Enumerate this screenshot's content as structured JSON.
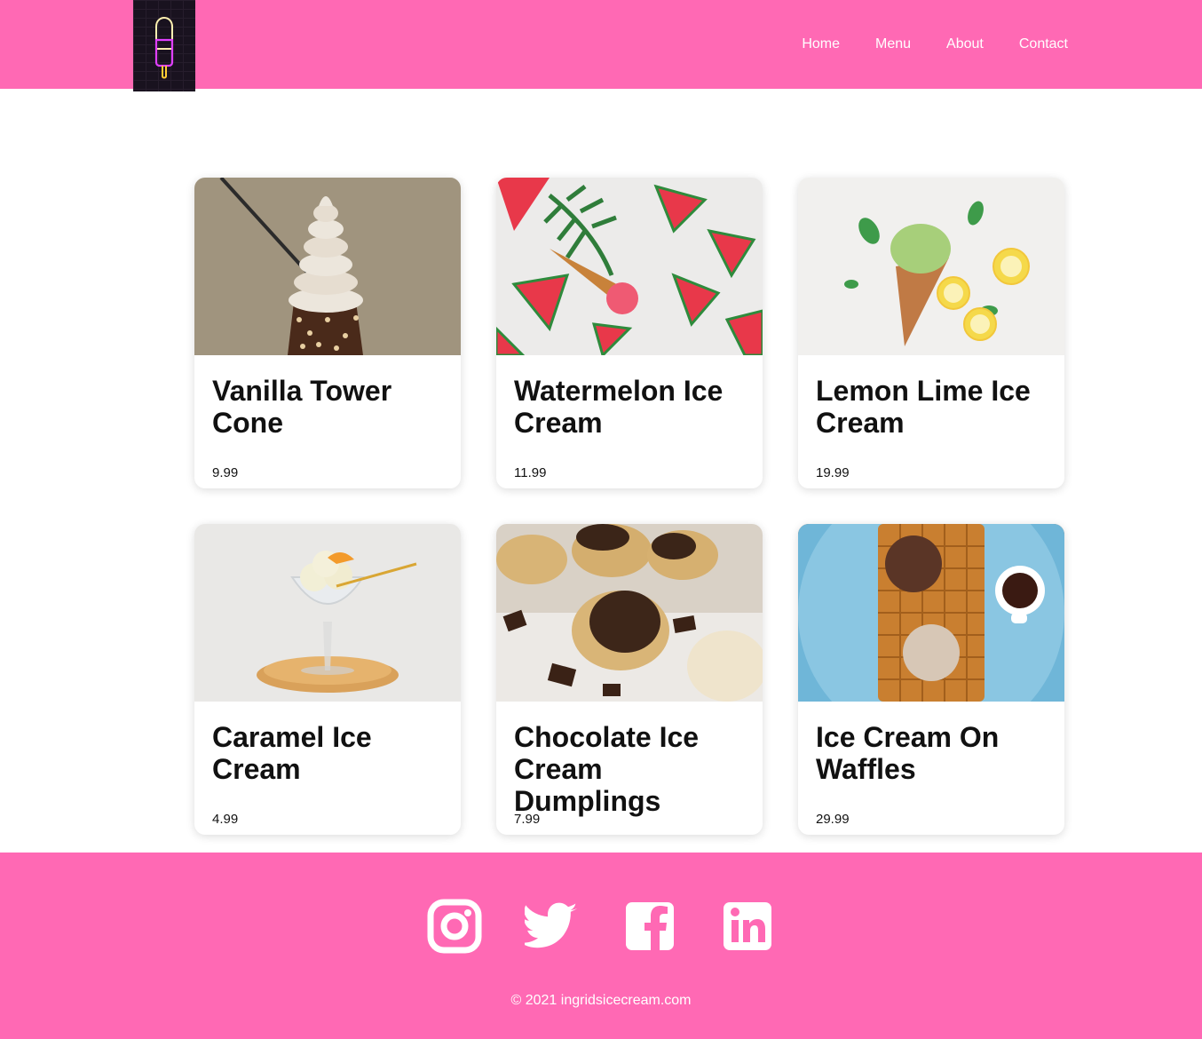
{
  "header": {
    "logo_icon": "neon-popsicle-icon",
    "nav": [
      {
        "label": "Home"
      },
      {
        "label": "Menu"
      },
      {
        "label": "About"
      },
      {
        "label": "Contact"
      }
    ]
  },
  "products": [
    {
      "name": "Vanilla Tower Cone",
      "price": "9.99"
    },
    {
      "name": "Watermelon Ice Cream",
      "price": "11.99"
    },
    {
      "name": "Lemon Lime Ice Cream",
      "price": "19.99"
    },
    {
      "name": "Caramel Ice Cream",
      "price": "4.99"
    },
    {
      "name": "Chocolate Ice Cream Dumplings",
      "price": "7.99"
    },
    {
      "name": "Ice Cream On Waffles",
      "price": "29.99"
    }
  ],
  "footer": {
    "socials": [
      "instagram-icon",
      "twitter-icon",
      "facebook-icon",
      "linkedin-icon"
    ],
    "copyright": "© 2021 ingridsicecream.com"
  },
  "colors": {
    "brand_pink": "#ff69b4",
    "logo_bg": "#19121f"
  }
}
